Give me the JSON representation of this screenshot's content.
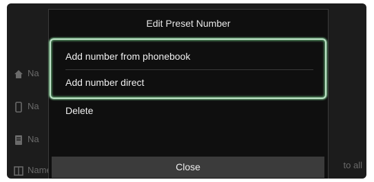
{
  "dialog": {
    "title": "Edit Preset Number",
    "items": [
      {
        "label": "Add number from phonebook"
      },
      {
        "label": "Add number direct"
      },
      {
        "label": "Delete"
      }
    ],
    "close_label": "Close"
  },
  "background": {
    "rows": [
      {
        "icon": "home-icon",
        "text": "Na"
      },
      {
        "icon": "phone-icon",
        "text": "Na"
      },
      {
        "icon": "phonebook-icon",
        "text": "Na"
      },
      {
        "icon": "book-icon",
        "text": "Name (Mobile)"
      }
    ],
    "right_text": "to all"
  },
  "colors": {
    "screen": "#1c1c1c",
    "dialog": "#0f0f0f",
    "highlight": "#bfe3c8",
    "close_button": "#3b3b3b"
  }
}
